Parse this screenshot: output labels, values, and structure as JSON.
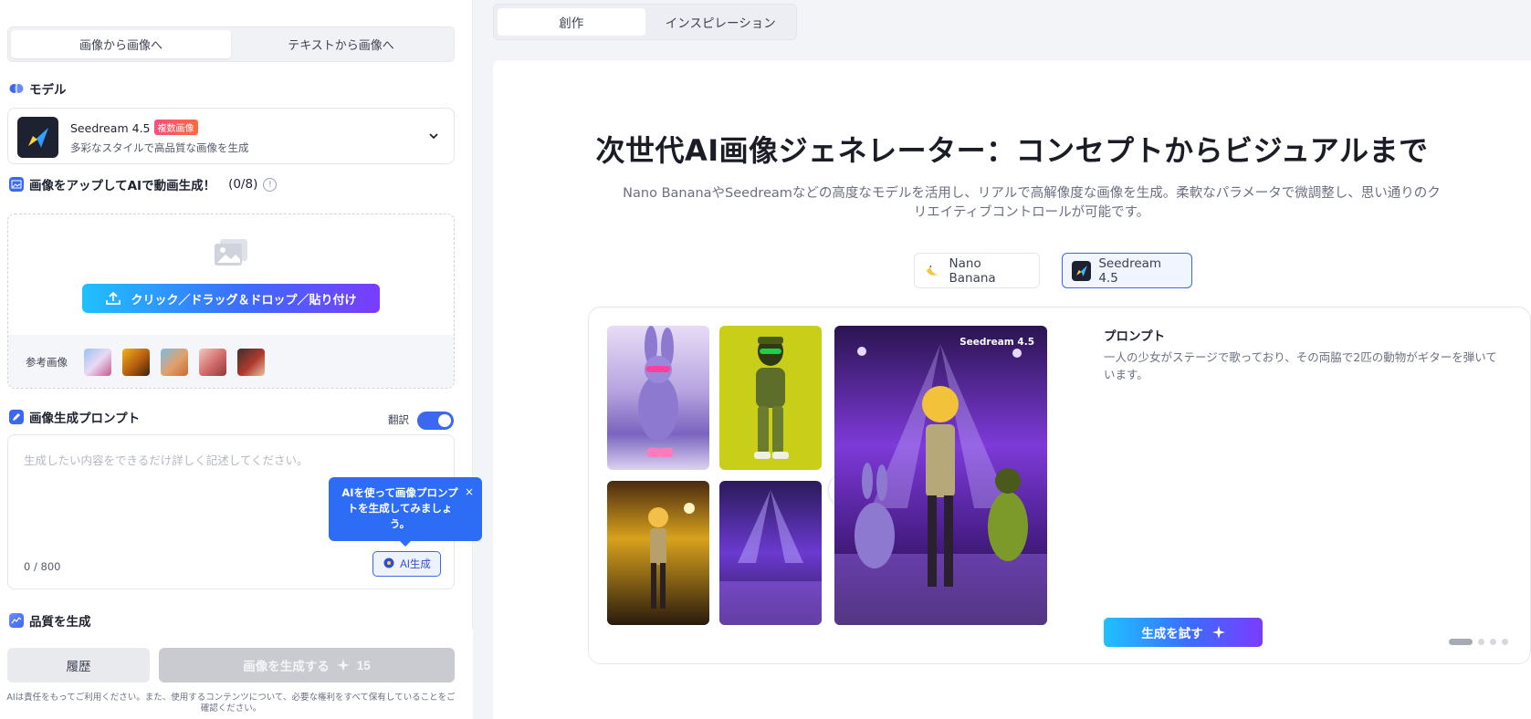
{
  "sidebar": {
    "mode_tabs": [
      {
        "label": "画像から画像へ",
        "active": true
      },
      {
        "label": "テキストから画像へ",
        "active": false
      }
    ],
    "model_section": {
      "title": "モデル",
      "model_name": "Seedream 4.5",
      "badge": "複数画像",
      "description": "多彩なスタイルで高品質な画像を生成"
    },
    "upload_section": {
      "title": "画像をアップしてAIで動画生成！",
      "count": "(0/8)",
      "button_label": "クリック／ドラッグ＆ドロップ／貼り付け",
      "reference_label": "参考画像"
    },
    "prompt_section": {
      "title": "画像生成プロンプト",
      "translate_label": "翻訳",
      "translate_on": true,
      "placeholder": "生成したい内容をできるだけ詳しく記述してください。",
      "counter": "0 / 800",
      "ai_button_label": "AI生成",
      "tooltip_text": "AIを使って画像プロンプトを生成してみましょう。",
      "tooltip_close": "×"
    },
    "quality_section": {
      "title": "品質を生成"
    },
    "footer": {
      "history_label": "履歴",
      "generate_label": "画像を生成する",
      "generate_cost": "15",
      "disclaimer": "AIは責任をもってご利用ください。また、使用するコンテンツについて、必要な権利をすべて保有していることをご確認ください。"
    }
  },
  "top_tabs": [
    {
      "label": "創作",
      "active": true
    },
    {
      "label": "インスピレーション",
      "active": false
    }
  ],
  "hero": {
    "title": "次世代AI画像ジェネレーター：コンセプトからビジュアルまで",
    "subtitle": "Nano BananaやSeedreamなどの高度なモデルを活用し、リアルで高解像度な画像を生成。柔軟なパラメータで微調整し、思い通りのクリエイティブコントロールが可能です。"
  },
  "model_chips": [
    {
      "label": "Nano Banana",
      "active": false
    },
    {
      "label": "Seedream 4.5",
      "active": true
    }
  ],
  "showcase": {
    "result_badge": "Seedream 4.5",
    "prompt_heading": "プロンプト",
    "prompt_text": "一人の少女がステージで歌っており、その両脇で2匹の動物がギターを弾いています。",
    "try_button_label": "生成を試す",
    "pager": {
      "total": 4,
      "current": 1
    }
  },
  "colors": {
    "accent": "#3c68f0",
    "gradient_start": "#1fc1ff",
    "gradient_end": "#7a3cff"
  }
}
